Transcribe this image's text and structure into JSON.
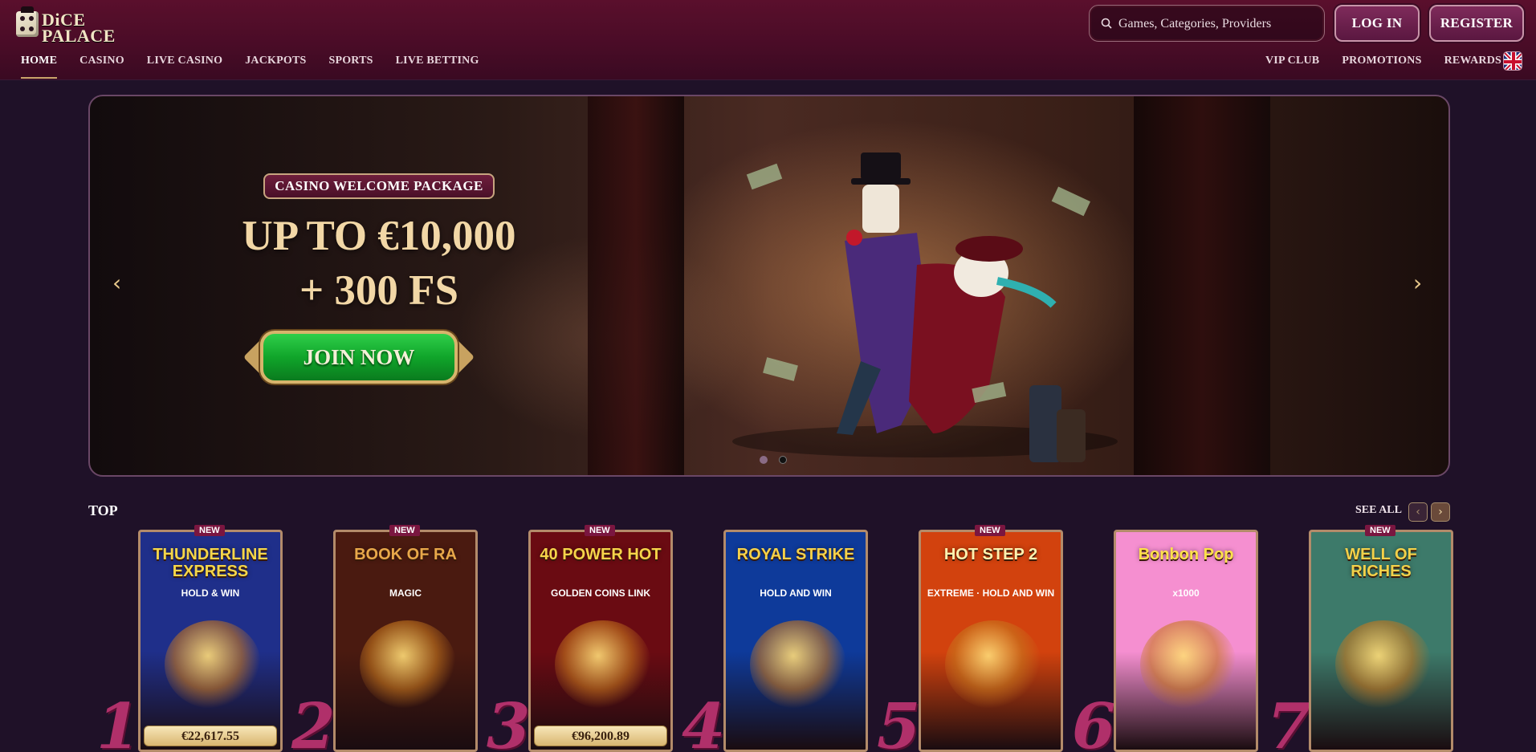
{
  "brand": {
    "line1": "DiCE",
    "line2": "PALACE"
  },
  "search": {
    "placeholder": "Games, Categories, Providers"
  },
  "header": {
    "login_label": "LOG IN",
    "register_label": "REGISTER"
  },
  "nav": {
    "left": [
      {
        "label": "HOME",
        "active": true
      },
      {
        "label": "CASINO"
      },
      {
        "label": "LIVE CASINO"
      },
      {
        "label": "JACKPOTS"
      },
      {
        "label": "SPORTS"
      },
      {
        "label": "LIVE BETTING"
      }
    ],
    "right": [
      {
        "label": "VIP CLUB"
      },
      {
        "label": "PROMOTIONS"
      },
      {
        "label": "REWARDS"
      }
    ],
    "language_icon": "uk-flag-icon"
  },
  "hero": {
    "badge": "CASINO WELCOME PACKAGE",
    "headline_1": "UP TO €10,000",
    "headline_2": "+ 300 FS",
    "cta_label": "JOIN NOW",
    "prev_icon": "chevron-left-icon",
    "next_icon": "chevron-right-icon",
    "slides_total": 2,
    "active_slide": 2
  },
  "top": {
    "title": "TOP",
    "see_all": "SEE ALL",
    "games": [
      {
        "rank": "1",
        "badge": "NEW",
        "title": "THUNDERLINE EXPRESS",
        "subtitle": "HOLD & WIN",
        "jackpot": "€22,617.55",
        "bg": "#1f2f8a"
      },
      {
        "rank": "2",
        "badge": "NEW",
        "title": "BOOK OF RA",
        "subtitle": "MAGIC",
        "jackpot": "",
        "bg": "#4a1a10"
      },
      {
        "rank": "3",
        "badge": "NEW",
        "title": "40 POWER HOT",
        "subtitle": "GOLDEN COINS LINK",
        "jackpot": "€96,200.89",
        "bg": "#6a0b12"
      },
      {
        "rank": "4",
        "badge": "",
        "title": "ROYAL STRIKE",
        "subtitle": "HOLD AND WIN",
        "jackpot": "",
        "bg": "#0e3a9a"
      },
      {
        "rank": "5",
        "badge": "NEW",
        "title": "HOT STEP 2",
        "subtitle": "EXTREME · HOLD AND WIN",
        "jackpot": "",
        "bg": "#d2420e"
      },
      {
        "rank": "6",
        "badge": "",
        "title": "Bonbon Pop",
        "subtitle": "x1000",
        "jackpot": "",
        "bg": "#f58fd0"
      },
      {
        "rank": "7",
        "badge": "NEW",
        "title": "WELL OF RICHES",
        "subtitle": "",
        "jackpot": "",
        "bg": "#3d7a6a"
      }
    ]
  }
}
